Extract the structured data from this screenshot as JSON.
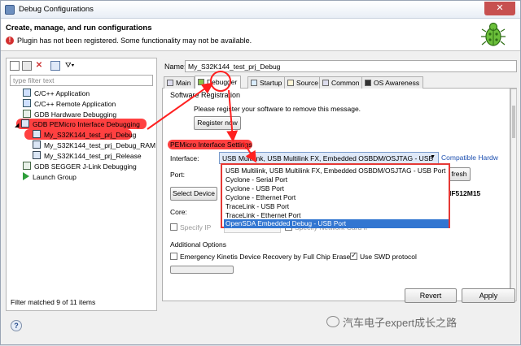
{
  "window": {
    "title": "Debug Configurations",
    "close_glyph": "✕"
  },
  "header": {
    "title": "Create, manage, and run configurations",
    "message": "Plugin has not been registered. Some functionality may not be available.",
    "error_glyph": "!"
  },
  "left": {
    "filter_placeholder": "type filter text",
    "tree": [
      {
        "label": "C/C++ Application",
        "icon": "c-app-icon"
      },
      {
        "label": "C/C++ Remote Application",
        "icon": "c-remote-icon"
      },
      {
        "label": "GDB Hardware Debugging",
        "icon": "gdb-hw-icon"
      },
      {
        "label": "GDB PEMicro Interface Debugging",
        "icon": "pemicro-icon"
      },
      {
        "label": "My_S32K144_test_prj_Debug",
        "icon": "config-icon"
      },
      {
        "label": "My_S32K144_test_prj_Debug_RAM",
        "icon": "config-icon"
      },
      {
        "label": "My_S32K144_test_prj_Release",
        "icon": "config-icon"
      },
      {
        "label": "GDB SEGGER J-Link Debugging",
        "icon": "segger-icon"
      },
      {
        "label": "Launch Group",
        "icon": "launch-group-icon"
      }
    ],
    "status": "Filter matched 9 of 11 items"
  },
  "right": {
    "name_label": "Name:",
    "name_value": "My_S32K144_test_prj_Debug",
    "tabs": [
      "Main",
      "Debugger",
      "Startup",
      "Source",
      "Common",
      "OS Awareness"
    ],
    "software_registration": "Software Registration",
    "register_msg": "Please register your software to remove this message.",
    "register_button": "Register now",
    "pemicro_settings": "PEMicro Interface Settings",
    "interface_label": "Interface:",
    "interface_value": "USB Multilink, USB Multilink FX, Embedded OSBDM/OSJTAG - USB",
    "compatible_link": "Compatible Hardw",
    "port_label": "Port:",
    "refresh_button": "fresh",
    "select_device_button": "Select Device",
    "device_value": "IF512M15",
    "core_label": "Core:",
    "specify_ip": "Specify IP",
    "network_card_fragment": "Specify Network Card IP",
    "interface_options": [
      "USB Multilink, USB Multilink FX, Embedded OSBDM/OSJTAG - USB Port",
      "Cyclone - Serial Port",
      "Cyclone - USB Port",
      "Cyclone - Ethernet Port",
      "TraceLink - USB Port",
      "TraceLink - Ethernet Port",
      "OpenSDA Embedded Debug - USB Port"
    ],
    "additional_options": "Additional Options",
    "emergency_kinetis": "Emergency Kinetis Device Recovery by Full Chip Erase",
    "use_swd": "Use SWD protocol",
    "revert_button": "Revert",
    "apply_button": "Apply"
  },
  "watermark": "汽车电子expert成长之路",
  "help_glyph": "?",
  "colors": {
    "annotation_red": "#ff3030",
    "selection_blue": "#3276d1"
  }
}
